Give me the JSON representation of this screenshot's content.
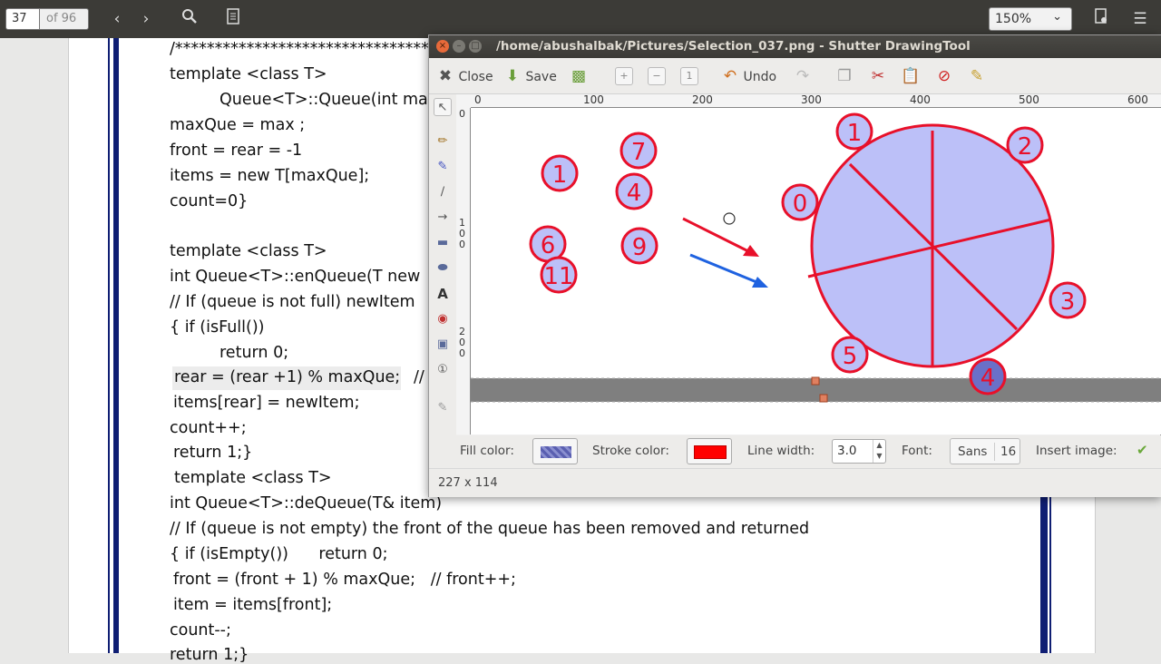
{
  "pdf_toolbar": {
    "page_number": "37",
    "page_total": "of 96",
    "zoom": "150%"
  },
  "document": {
    "lines": [
      "/***********************************",
      "template <class T>",
      "Queue<T>::Queue(int ma",
      "maxQue = max ;",
      "front = rear = -1",
      "items = new T[maxQue];",
      "count=0}",
      "template <class T>",
      "int Queue<T>::enQueue(T new",
      "// If (queue is not full) newItem",
      "{ if (isFull())",
      "return 0;",
      "rear = (rear +1) % maxQue;",
      "//",
      "items[rear] = newItem;",
      "count++;",
      "return 1;}",
      "template <class T>",
      "int Queue<T>::deQueue(T& item)",
      "// If (queue is not empty) the front of the queue has been removed and returned",
      "{ if (isEmpty())      return 0;",
      "front = (front + 1) % maxQue;   // front++;",
      "item = items[front];",
      "count--;",
      "return 1;}"
    ]
  },
  "shutter": {
    "title": "/home/abushalbak/Pictures/Selection_037.png - Shutter DrawingTool",
    "toolbar": {
      "close_label": "Close",
      "save_label": "Save",
      "undo_label": "Undo"
    },
    "ruler_top": [
      "0",
      "100",
      "200",
      "300",
      "400",
      "500",
      "600"
    ],
    "ruler_left": [
      "0",
      "1",
      "0",
      "0",
      "2",
      "0",
      "0"
    ],
    "canvas_numbers": [
      "1",
      "7",
      "4",
      "6",
      "9",
      "11",
      "0",
      "1",
      "2",
      "3",
      "5",
      "4"
    ],
    "props": {
      "fill_label": "Fill color:",
      "stroke_label": "Stroke color:",
      "line_width_label": "Line width:",
      "line_width_value": "3.0",
      "font_label": "Font:",
      "font_name": "Sans",
      "font_size": "16",
      "insert_image_label": "Insert image:"
    },
    "status_size": "227 x 114"
  },
  "colors": {
    "accent_red": "#e8102a",
    "fill_blue": "#bcc0f8",
    "arrow_blue": "#1f62e0",
    "page_border": "#0f1e73"
  }
}
